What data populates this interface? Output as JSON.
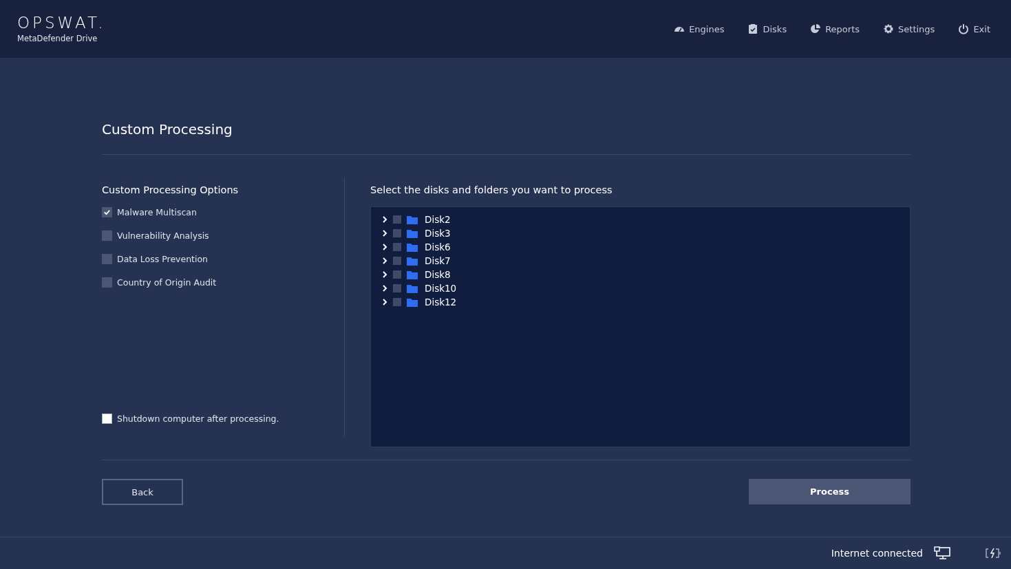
{
  "header": {
    "logo": "OPSWAT.",
    "product": "MetaDefender Drive",
    "nav": [
      {
        "label": "Engines"
      },
      {
        "label": "Disks"
      },
      {
        "label": "Reports"
      },
      {
        "label": "Settings"
      },
      {
        "label": "Exit"
      }
    ]
  },
  "title": "Custom Processing",
  "options": {
    "heading": "Custom Processing Options",
    "items": [
      {
        "label": "Malware Multiscan",
        "checked": true
      },
      {
        "label": "Vulnerability Analysis",
        "checked": false
      },
      {
        "label": "Data Loss Prevention",
        "checked": false
      },
      {
        "label": "Country of Origin Audit",
        "checked": false
      }
    ],
    "shutdown": {
      "label": "Shutdown computer after processing.",
      "checked": false
    }
  },
  "tree": {
    "heading": "Select the disks and folders you want to process",
    "items": [
      {
        "label": "Disk2",
        "checked": false,
        "expanded": false
      },
      {
        "label": "Disk3",
        "checked": false,
        "expanded": false
      },
      {
        "label": "Disk6",
        "checked": false,
        "expanded": false
      },
      {
        "label": "Disk7",
        "checked": false,
        "expanded": false
      },
      {
        "label": "Disk8",
        "checked": false,
        "expanded": false
      },
      {
        "label": "Disk10",
        "checked": false,
        "expanded": false
      },
      {
        "label": "Disk12",
        "checked": false,
        "expanded": false
      }
    ]
  },
  "buttons": {
    "back": "Back",
    "process": "Process"
  },
  "status_bar": {
    "text": "Internet connected"
  }
}
